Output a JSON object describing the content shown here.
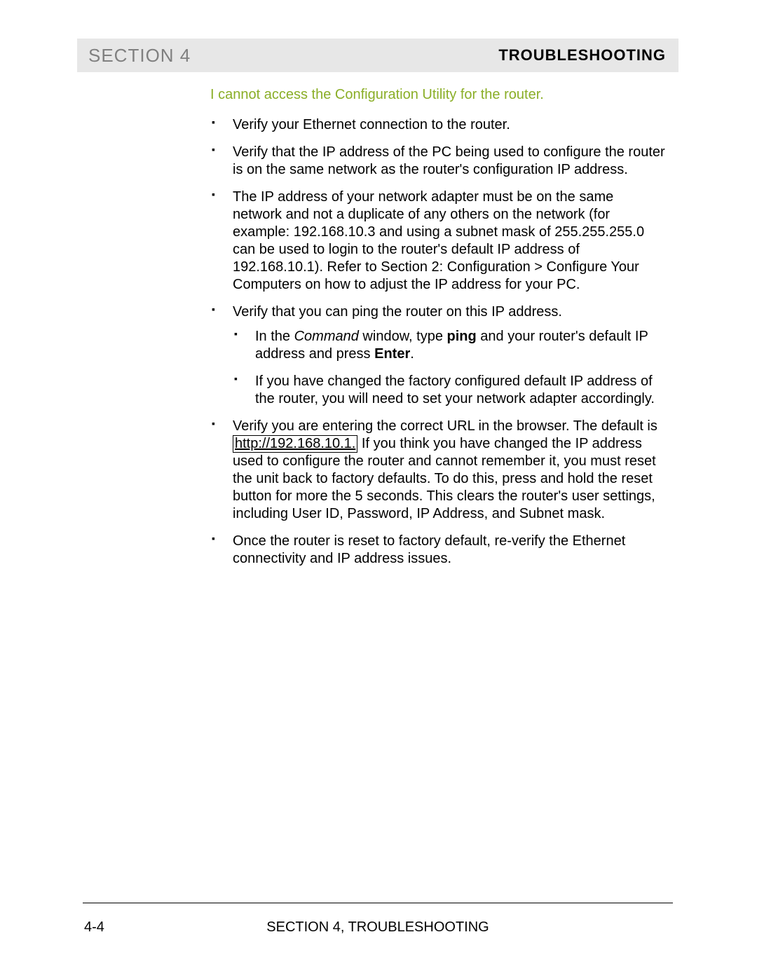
{
  "header": {
    "left": "SECTION 4",
    "right": "TROUBLESHOOTING"
  },
  "topic_heading": "I cannot access the Configuration Utility for the router.",
  "bullets": {
    "b0": "Verify your Ethernet connection to the router.",
    "b1": "Verify that the IP address of the PC being used to configure the router is on the same network as the router's configuration IP address.",
    "b2": "The IP address of your network adapter must be on the same network and not a duplicate of any others on the network (for example: 192.168.10.3 and using a subnet mask of 255.255.255.0 can be used to login to the router's default IP address of 192.168.10.1). Refer to Section 2: Configuration > Configure Your Computers on how to adjust the IP address for your PC.",
    "b3": "Verify that you can ping the router on this IP address.",
    "b3_sub0_pre": "In the ",
    "b3_sub0_italic": "Command",
    "b3_sub0_mid": " window, type ",
    "b3_sub0_bold1": "ping",
    "b3_sub0_post1": " and your router's default IP address and press ",
    "b3_sub0_bold2": "Enter",
    "b3_sub0_post2": ".",
    "b3_sub1": "If you have changed the factory configured default IP address of the router, you will need to set your network adapter accordingly.",
    "b4_pre": "Verify you are entering the correct URL in the browser. The default is ",
    "b4_link": "http://192.168.10.1.",
    "b4_post": " If you think you have changed the IP address used to configure the router and cannot remember it, you must reset the unit back to factory defaults. To do this, press and hold the reset button for more the 5 seconds. This clears the router's user settings, including User ID, Password, IP Address, and Subnet mask.",
    "b5": "Once the router is reset to factory default, re-verify the Ethernet connectivity and IP address issues."
  },
  "footer": {
    "page_number": "4-4",
    "center": "SECTION 4, TROUBLESHOOTING"
  }
}
